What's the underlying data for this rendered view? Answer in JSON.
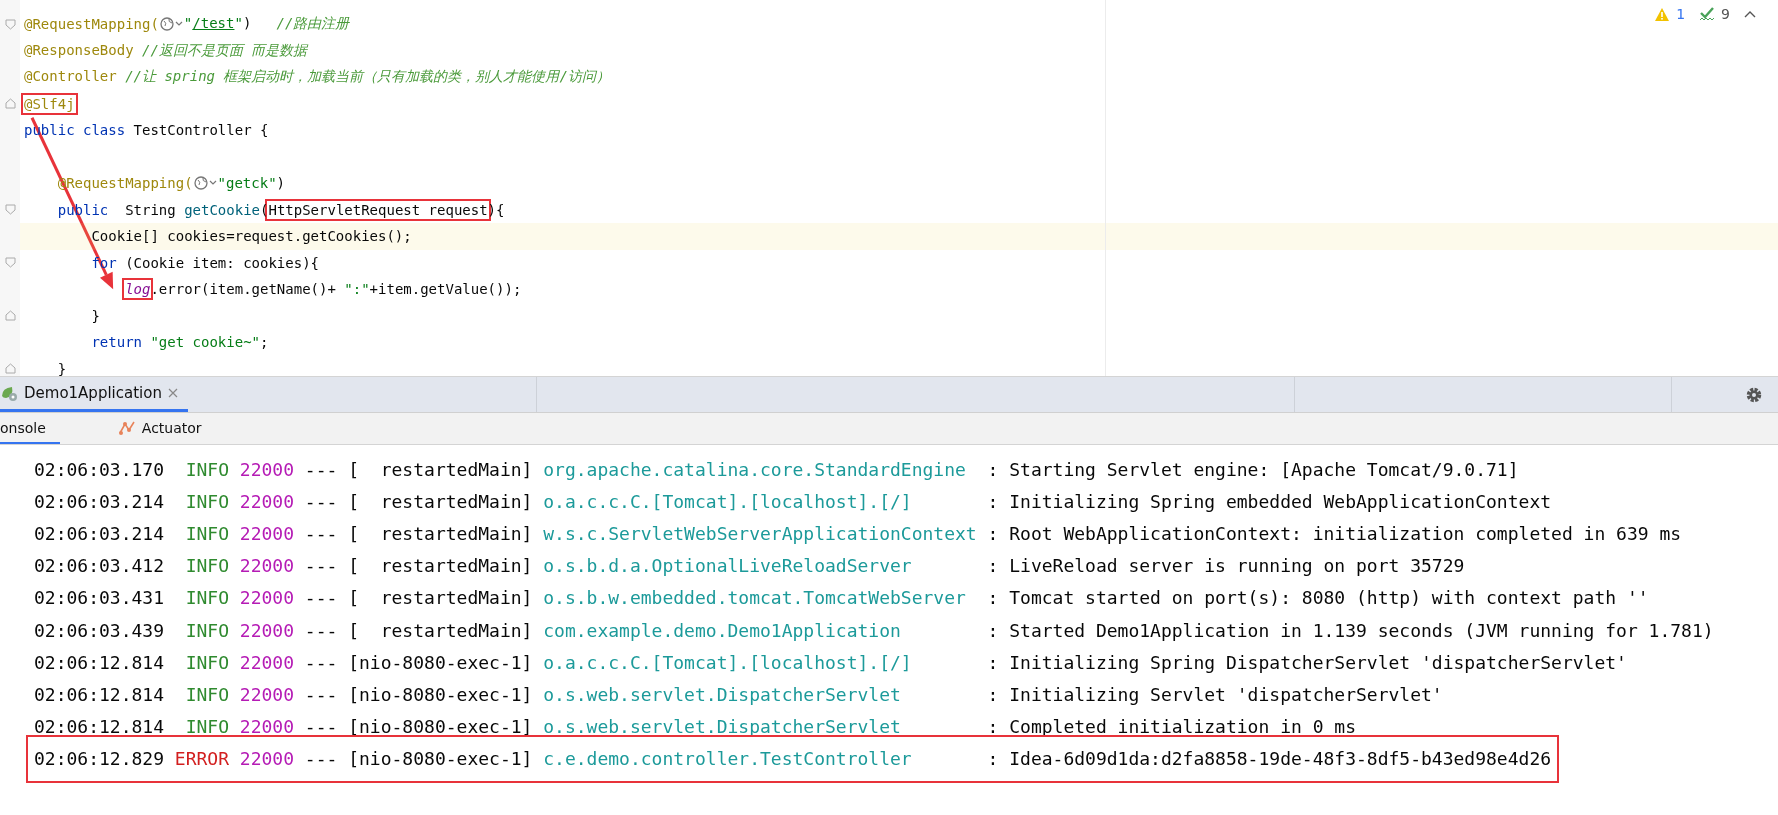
{
  "editor": {
    "inspections": {
      "warnings": "1",
      "weak_warnings": "9"
    },
    "lines": [
      {
        "fold_start": true,
        "current": false,
        "tokens": [
          {
            "kind": "annotation",
            "text": "@RequestMapping("
          },
          {
            "kind": "hint"
          },
          {
            "kind": "string",
            "text": "\""
          },
          {
            "kind": "link",
            "text": "/test"
          },
          {
            "kind": "string",
            "text": "\""
          },
          {
            "kind": "plain",
            "text": ")   "
          },
          {
            "kind": "comment",
            "text": "//路由注册"
          }
        ]
      },
      {
        "current": false,
        "tokens": [
          {
            "kind": "annotation",
            "text": "@ResponseBody "
          },
          {
            "kind": "comment",
            "text": "//返回不是页面 而是数据"
          }
        ]
      },
      {
        "current": false,
        "tokens": [
          {
            "kind": "annotation",
            "text": "@Controller "
          },
          {
            "kind": "comment",
            "text": "//让 spring 框架启动时，加载当前（只有加载的类，别人才能使用/访问）"
          }
        ]
      },
      {
        "fold_end": true,
        "current": false,
        "tokens": [
          {
            "kind": "annotation",
            "text": "@Slf4j",
            "boxed": true,
            "arrow_tail": true
          }
        ]
      },
      {
        "current": false,
        "tokens": [
          {
            "kind": "keyword",
            "text": "public class "
          },
          {
            "kind": "plain",
            "text": "TestController {"
          }
        ]
      },
      {
        "current": false
      },
      {
        "current": false,
        "tokens": [
          {
            "kind": "annotation",
            "text": "    @RequestMapping("
          },
          {
            "kind": "hint"
          },
          {
            "kind": "string",
            "text": "\"getck\""
          },
          {
            "kind": "plain",
            "text": ")"
          }
        ]
      },
      {
        "fold_start": true,
        "current": false,
        "tokens": [
          {
            "kind": "keyword",
            "text": "    public"
          },
          {
            "kind": "plain",
            "text": "  String "
          },
          {
            "kind": "method",
            "text": "getCookie"
          },
          {
            "kind": "plain",
            "text": "("
          },
          {
            "kind": "plain",
            "text": "HttpServletRequest request",
            "boxed": true
          },
          {
            "kind": "plain",
            "text": "){"
          }
        ]
      },
      {
        "current": true,
        "tokens": [
          {
            "kind": "plain",
            "text": "        Cookie[] cookies=request.getCookies();"
          }
        ]
      },
      {
        "fold_start": true,
        "current": false,
        "tokens": [
          {
            "kind": "keyword",
            "text": "        for"
          },
          {
            "kind": "plain",
            "text": " (Cookie item: cookies){"
          }
        ]
      },
      {
        "current": false,
        "tokens": [
          {
            "kind": "field",
            "text": "            log",
            "boxed": true,
            "arrow_head": true
          },
          {
            "kind": "plain",
            "text": ".error(item.getName()+ "
          },
          {
            "kind": "string",
            "text": "\":\""
          },
          {
            "kind": "plain",
            "text": "+item.getValue());"
          }
        ]
      },
      {
        "fold_end": true,
        "current": false,
        "tokens": [
          {
            "kind": "plain",
            "text": "        }"
          }
        ]
      },
      {
        "current": false,
        "tokens": [
          {
            "kind": "keyword",
            "text": "        return "
          },
          {
            "kind": "string",
            "text": "\"get cookie~\""
          },
          {
            "kind": "plain",
            "text": ";"
          }
        ]
      },
      {
        "fold_end": true,
        "current": false,
        "tokens": [
          {
            "kind": "plain",
            "text": "    }"
          }
        ]
      }
    ]
  },
  "run_tabs": [
    {
      "label": "Demo1Application",
      "selected": true
    }
  ],
  "tool_tabs": [
    {
      "label": "onsole",
      "selected": true,
      "kind": "console"
    },
    {
      "label": "Actuator",
      "selected": false,
      "kind": "actuator"
    }
  ],
  "console": {
    "rows": [
      {
        "time": "02:06:03.170",
        "level": "INFO",
        "kind": "info",
        "pid": "22000",
        "sep": "---",
        "thread": "[  restartedMain]",
        "logger": "org.apache.catalina.core.StandardEngine",
        "message": ": Starting Servlet engine: [Apache Tomcat/9.0.71]",
        "boxed": false
      },
      {
        "time": "02:06:03.214",
        "level": "INFO",
        "kind": "info",
        "pid": "22000",
        "sep": "---",
        "thread": "[  restartedMain]",
        "logger": "o.a.c.c.C.[Tomcat].[localhost].[/]",
        "message": ": Initializing Spring embedded WebApplicationContext",
        "boxed": false
      },
      {
        "time": "02:06:03.214",
        "level": "INFO",
        "kind": "info",
        "pid": "22000",
        "sep": "---",
        "thread": "[  restartedMain]",
        "logger": "w.s.c.ServletWebServerApplicationContext",
        "message": ": Root WebApplicationContext: initialization completed in 639 ms",
        "boxed": false
      },
      {
        "time": "02:06:03.412",
        "level": "INFO",
        "kind": "info",
        "pid": "22000",
        "sep": "---",
        "thread": "[  restartedMain]",
        "logger": "o.s.b.d.a.OptionalLiveReloadServer",
        "message": ": LiveReload server is running on port 35729",
        "boxed": false
      },
      {
        "time": "02:06:03.431",
        "level": "INFO",
        "kind": "info",
        "pid": "22000",
        "sep": "---",
        "thread": "[  restartedMain]",
        "logger": "o.s.b.w.embedded.tomcat.TomcatWebServer",
        "message": ": Tomcat started on port(s): 8080 (http) with context path ''",
        "boxed": false
      },
      {
        "time": "02:06:03.439",
        "level": "INFO",
        "kind": "info",
        "pid": "22000",
        "sep": "---",
        "thread": "[  restartedMain]",
        "logger": "com.example.demo.Demo1Application",
        "message": ": Started Demo1Application in 1.139 seconds (JVM running for 1.781)",
        "boxed": false
      },
      {
        "time": "02:06:12.814",
        "level": "INFO",
        "kind": "info",
        "pid": "22000",
        "sep": "---",
        "thread": "[nio-8080-exec-1]",
        "logger": "o.a.c.c.C.[Tomcat].[localhost].[/]",
        "message": ": Initializing Spring DispatcherServlet 'dispatcherServlet'",
        "boxed": false
      },
      {
        "time": "02:06:12.814",
        "level": "INFO",
        "kind": "info",
        "pid": "22000",
        "sep": "---",
        "thread": "[nio-8080-exec-1]",
        "logger": "o.s.web.servlet.DispatcherServlet",
        "message": ": Initializing Servlet 'dispatcherServlet'",
        "boxed": false
      },
      {
        "time": "02:06:12.814",
        "level": "INFO",
        "kind": "info",
        "pid": "22000",
        "sep": "---",
        "thread": "[nio-8080-exec-1]",
        "logger": "o.s.web.servlet.DispatcherServlet",
        "message": ": Completed initialization in 0 ms",
        "boxed": false
      },
      {
        "time": "02:06:12.829",
        "level": "ERROR",
        "kind": "error",
        "pid": "22000",
        "sep": "---",
        "thread": "[nio-8080-exec-1]",
        "logger": "c.e.demo.controller.TestController",
        "message": ": Idea-6d09d1da:d2fa8858-19de-48f3-8df5-b43ed98e4d26",
        "boxed": true
      }
    ]
  }
}
